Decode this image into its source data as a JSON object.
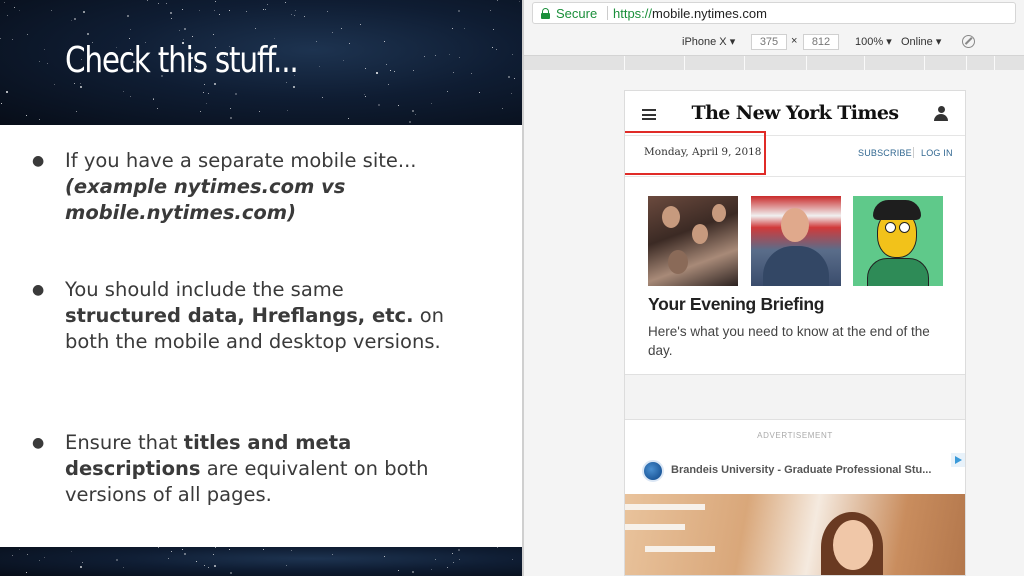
{
  "slide": {
    "title": "Check this stuff...",
    "bullets": [
      {
        "marker": "●",
        "text": "If you have a separate mobile site...",
        "emphasis": "(example nytimes.com vs mobile.nytimes.com)"
      },
      {
        "marker": "●",
        "pre": "You should include the same",
        "bold": "structured data, Hreflangs, etc.",
        "post": "on both the mobile and desktop versions."
      },
      {
        "marker": "●",
        "pre": "Ensure that",
        "bold": "titles and meta descriptions",
        "post": "are equivalent on both versions of all pages."
      }
    ]
  },
  "browser": {
    "secure_label": "Secure",
    "url_scheme": "https://",
    "url_host": "mobile.nytimes.com",
    "device": "iPhone X ▾",
    "width": "375",
    "times": "×",
    "height": "812",
    "zoom": "100% ▾",
    "network": "Online ▾"
  },
  "page": {
    "logo": "The New York Times",
    "date": "Monday, April 9, 2018",
    "subscribe": "SUBSCRIBE",
    "login": "LOG IN",
    "headline": "Your Evening Briefing",
    "summary": "Here's what you need to know at the end of the day.",
    "ad_label": "ADVERTISEMENT",
    "ad_text": "Brandeis University - Graduate Professional Stu..."
  },
  "colors": {
    "secure_green": "#1a8f3a",
    "highlight_red": "#e02b27",
    "link_blue": "#326891"
  },
  "icons": [
    "lock-icon",
    "rotate-icon",
    "menu-icon",
    "user-icon",
    "adchoices-icon"
  ]
}
